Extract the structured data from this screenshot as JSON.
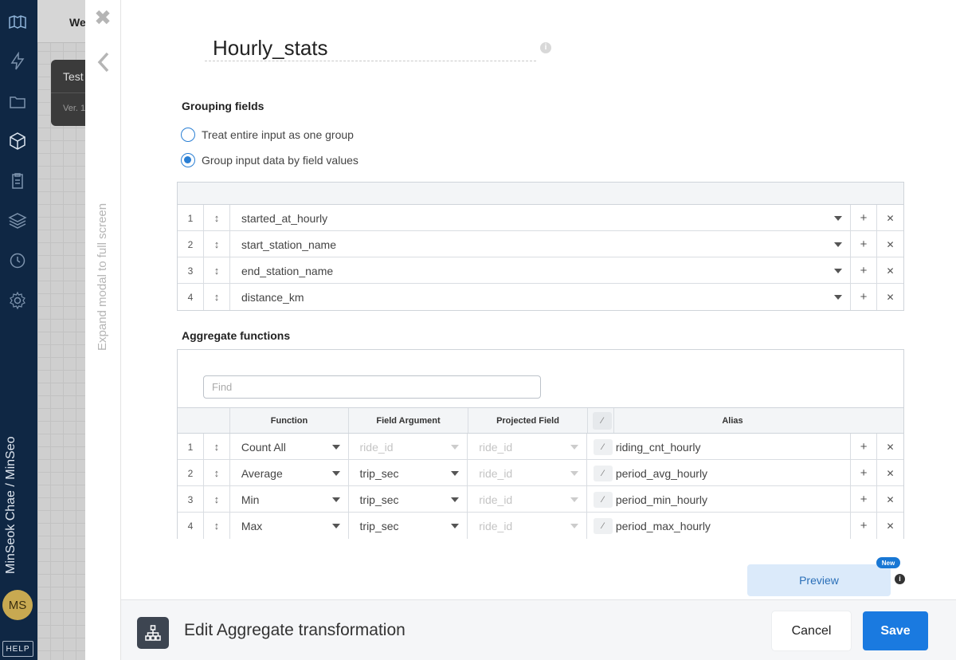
{
  "sidebar": {
    "user_name": "MinSeok Chae / MinSeo",
    "avatar_initials": "MS",
    "help_label": "HELP",
    "icons": [
      "logo-icon",
      "bolt-icon",
      "folder-icon",
      "cube-icon",
      "clipboard-icon",
      "layers-icon",
      "history-icon",
      "gear-icon"
    ]
  },
  "background": {
    "tab_label": "We",
    "card_title": "Test",
    "card_version": "Ver. 1"
  },
  "modal": {
    "expand_label": "Expand modal to full screen",
    "title": "Hourly_stats",
    "grouping": {
      "label": "Grouping fields",
      "options": [
        "Treat entire input as one group",
        "Group input data by field values"
      ],
      "selected": 1,
      "rows": [
        {
          "num": "1",
          "field": "started_at_hourly"
        },
        {
          "num": "2",
          "field": "start_station_name"
        },
        {
          "num": "3",
          "field": "end_station_name"
        },
        {
          "num": "4",
          "field": "distance_km"
        }
      ]
    },
    "aggregate": {
      "label": "Aggregate functions",
      "find_placeholder": "Find",
      "headers": {
        "function": "Function",
        "field_argument": "Field Argument",
        "projected_field": "Projected Field",
        "alias": "Alias"
      },
      "rows": [
        {
          "num": "1",
          "function": "Count All",
          "argument": "ride_id",
          "argument_dim": true,
          "projected": "ride_id",
          "alias": "riding_cnt_hourly"
        },
        {
          "num": "2",
          "function": "Average",
          "argument": "trip_sec",
          "argument_dim": false,
          "projected": "ride_id",
          "alias": "period_avg_hourly"
        },
        {
          "num": "3",
          "function": "Min",
          "argument": "trip_sec",
          "argument_dim": false,
          "projected": "ride_id",
          "alias": "period_min_hourly"
        },
        {
          "num": "4",
          "function": "Max",
          "argument": "trip_sec",
          "argument_dim": false,
          "projected": "ride_id",
          "alias": "period_max_hourly"
        }
      ]
    },
    "preview_label": "Preview",
    "new_badge": "New"
  },
  "footer": {
    "title": "Edit Aggregate transformation",
    "cancel_label": "Cancel",
    "save_label": "Save"
  },
  "colors": {
    "nav_bg": "#0f2744",
    "accent": "#1a7ae0",
    "preview_bg": "#dbeafa"
  }
}
